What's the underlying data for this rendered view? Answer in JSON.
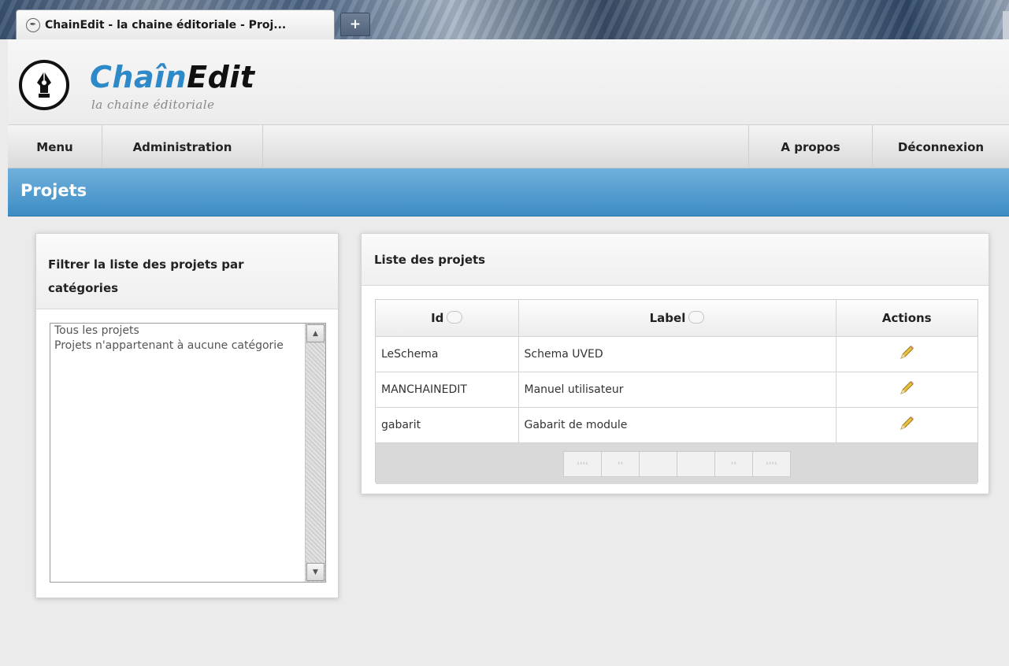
{
  "browser": {
    "tab_title": "ChainEdit - la chaine éditoriale - Proj...",
    "new_tab_label": "+"
  },
  "logo": {
    "title_part1": "Chaîn",
    "title_part2": "Edit",
    "subtitle": "la chaine éditoriale"
  },
  "nav": {
    "menu": "Menu",
    "administration": "Administration",
    "about": "A propos",
    "logout": "Déconnexion"
  },
  "page": {
    "title": "Projets"
  },
  "filter": {
    "heading_line1": "Filtrer la liste des projets par",
    "heading_line2": "catégories",
    "options": [
      "Tous les projets",
      "Projets n'appartenant à aucune catégorie"
    ]
  },
  "projects": {
    "heading": "Liste des projets",
    "columns": [
      "Id",
      "Label",
      "Actions"
    ],
    "rows": [
      {
        "id": "LeSchema",
        "label": "Schema UVED"
      },
      {
        "id": "MANCHAINEDIT",
        "label": "Manuel utilisateur"
      },
      {
        "id": "gabarit",
        "label": "Gabarit de module"
      }
    ],
    "pager": [
      "‹‹‹‹",
      "‹‹",
      "",
      "",
      "››",
      "››››"
    ]
  },
  "colors": {
    "accent_blue": "#3d8cc4",
    "logo_blue": "#2d89c7"
  },
  "icons": {
    "edit": "pencil-icon",
    "sort": "sort-icon",
    "logo": "fountain-pen-icon"
  }
}
